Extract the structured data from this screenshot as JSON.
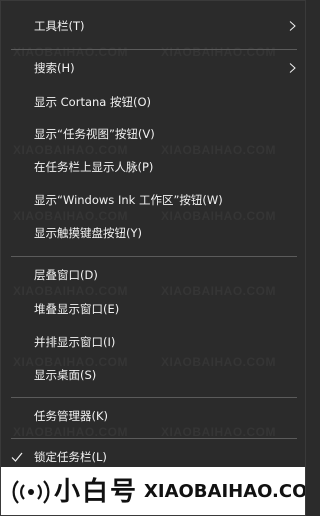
{
  "menu": {
    "items": [
      {
        "label": "工具栏(T)",
        "has_submenu": true
      },
      {
        "label": "搜索(H)",
        "has_submenu": true
      },
      {
        "label": "显示 Cortana 按钮(O)"
      },
      {
        "label": "显示“任务视图”按钮(V)"
      },
      {
        "label": "在任务栏上显示人脉(P)"
      },
      {
        "label": "显示“Windows Ink 工作区”按钮(W)"
      },
      {
        "label": "显示触摸键盘按钮(Y)"
      },
      {
        "label": "层叠窗口(D)"
      },
      {
        "label": "堆叠显示窗口(E)"
      },
      {
        "label": "并排显示窗口(I)"
      },
      {
        "label": "显示桌面(S)"
      },
      {
        "label": "任务管理器(K)"
      },
      {
        "label": "锁定任务栏(L)",
        "checked": true
      }
    ]
  },
  "watermark": {
    "text": "XIAOBAIHAO.COM",
    "brand_cn": "小白号",
    "brand_en": "XIAOBAIHAO.COM"
  },
  "colors": {
    "menu_background": "#2b2b2b",
    "menu_text": "#f2f2f2",
    "separator": "#5b5b5b",
    "banner_background": "#ffffff",
    "banner_text": "#111111"
  },
  "icons": {
    "submenu": "chevron-right-icon",
    "checked": "checkmark-icon",
    "logo": "signal-waves-icon"
  }
}
